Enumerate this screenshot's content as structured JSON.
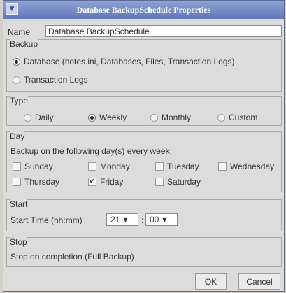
{
  "window": {
    "title": "Database BackupSchedule Properties"
  },
  "name": {
    "label": "Name",
    "value": "Database BackupSchedule"
  },
  "backup": {
    "legend": "Backup",
    "options": [
      {
        "label": "Database (notes.ini, Databases, Files, Transaction Logs)",
        "selected": true
      },
      {
        "label": "Transaction Logs",
        "selected": false
      }
    ]
  },
  "type": {
    "legend": "Type",
    "options": [
      {
        "label": "Daily",
        "selected": false
      },
      {
        "label": "Weekly",
        "selected": true
      },
      {
        "label": "Monthly",
        "selected": false
      },
      {
        "label": "Custom",
        "selected": false
      }
    ]
  },
  "day": {
    "legend": "Day",
    "instruction": "Backup on the following day(s) every week:",
    "days": [
      {
        "label": "Sunday",
        "checked": false
      },
      {
        "label": "Monday",
        "checked": false
      },
      {
        "label": "Tuesday",
        "checked": false
      },
      {
        "label": "Wednesday",
        "checked": false
      },
      {
        "label": "Thursday",
        "checked": false
      },
      {
        "label": "Friday",
        "checked": true
      },
      {
        "label": "Saturday",
        "checked": false
      }
    ]
  },
  "start": {
    "legend": "Start",
    "label": "Start Time (hh:mm)",
    "hour": "21",
    "minute": "00",
    "separator": ":"
  },
  "stop": {
    "legend": "Stop",
    "text": "Stop on completion (Full Backup)"
  },
  "buttons": {
    "ok": "OK",
    "cancel": "Cancel"
  }
}
